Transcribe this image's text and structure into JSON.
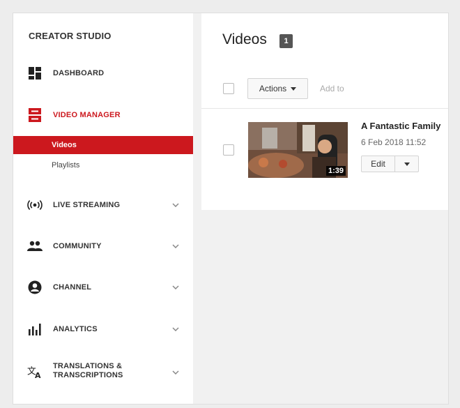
{
  "sidebar": {
    "brand": "CREATOR STUDIO",
    "items": [
      {
        "label": "DASHBOARD",
        "icon": "dashboard-icon"
      },
      {
        "label": "VIDEO MANAGER",
        "icon": "video-manager-icon",
        "active": true
      },
      {
        "label": "LIVE STREAMING",
        "icon": "live-streaming-icon"
      },
      {
        "label": "COMMUNITY",
        "icon": "community-icon"
      },
      {
        "label": "CHANNEL",
        "icon": "channel-icon"
      },
      {
        "label": "ANALYTICS",
        "icon": "analytics-icon"
      },
      {
        "label": "TRANSLATIONS &",
        "label2": "TRANSCRIPTIONS",
        "icon": "translate-icon"
      }
    ],
    "subitems": [
      {
        "label": "Videos",
        "active": true
      },
      {
        "label": "Playlists"
      }
    ]
  },
  "main": {
    "title": "Videos",
    "count": "1",
    "actions_label": "Actions",
    "add_to_label": "Add to",
    "video": {
      "title": "A Fantastic Family",
      "date": "6 Feb 2018 11:52",
      "duration": "1:39",
      "edit_label": "Edit"
    }
  },
  "colors": {
    "accent": "#cc181e",
    "background": "#f1f1f1",
    "panel": "#ffffff"
  }
}
